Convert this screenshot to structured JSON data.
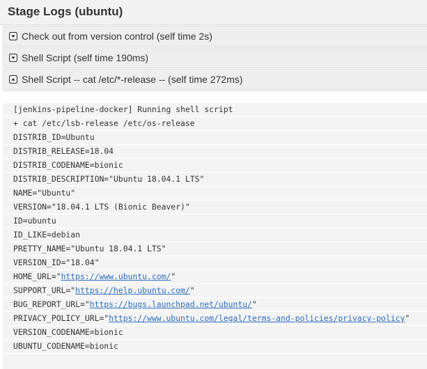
{
  "header": {
    "title": "Stage Logs (ubuntu)"
  },
  "stages": [
    {
      "label": "Check out from version control (self time 2s)",
      "icon": "chevron-down-icon"
    },
    {
      "label": "Shell Script (self time 190ms)",
      "icon": "chevron-down-icon"
    },
    {
      "label": "Shell Script -- cat /etc/*-release -- (self time 272ms)",
      "icon": "chevron-up-icon"
    }
  ],
  "log": {
    "lines": [
      {
        "text": "[jenkins-pipeline-docker] Running shell script"
      },
      {
        "text": "+ cat /etc/lsb-release /etc/os-release"
      },
      {
        "text": "DISTRIB_ID=Ubuntu"
      },
      {
        "text": "DISTRIB_RELEASE=18.04"
      },
      {
        "text": "DISTRIB_CODENAME=bionic"
      },
      {
        "text": "DISTRIB_DESCRIPTION=\"Ubuntu 18.04.1 LTS\""
      },
      {
        "text": "NAME=\"Ubuntu\""
      },
      {
        "text": "VERSION=\"18.04.1 LTS (Bionic Beaver)\""
      },
      {
        "text": "ID=ubuntu"
      },
      {
        "text": "ID_LIKE=debian"
      },
      {
        "text": "PRETTY_NAME=\"Ubuntu 18.04.1 LTS\""
      },
      {
        "text": "VERSION_ID=\"18.04\""
      },
      {
        "prefix": "HOME_URL=\"",
        "link": "https://www.ubuntu.com/",
        "suffix": "\""
      },
      {
        "prefix": "SUPPORT_URL=\"",
        "link": "https://help.ubuntu.com/",
        "suffix": "\""
      },
      {
        "prefix": "BUG_REPORT_URL=\"",
        "link": "https://bugs.launchpad.net/ubuntu/",
        "suffix": "\""
      },
      {
        "prefix": "PRIVACY_POLICY_URL=\"",
        "link": "https://www.ubuntu.com/legal/terms-and-policies/privacy-policy",
        "suffix": "\""
      },
      {
        "text": "VERSION_CODENAME=bionic"
      },
      {
        "text": "UBUNTU_CODENAME=bionic"
      }
    ]
  },
  "colors": {
    "link": "#2e6fbf",
    "stage_bg": "#eeeeee",
    "log_line_bg": "#f3f3f3"
  }
}
